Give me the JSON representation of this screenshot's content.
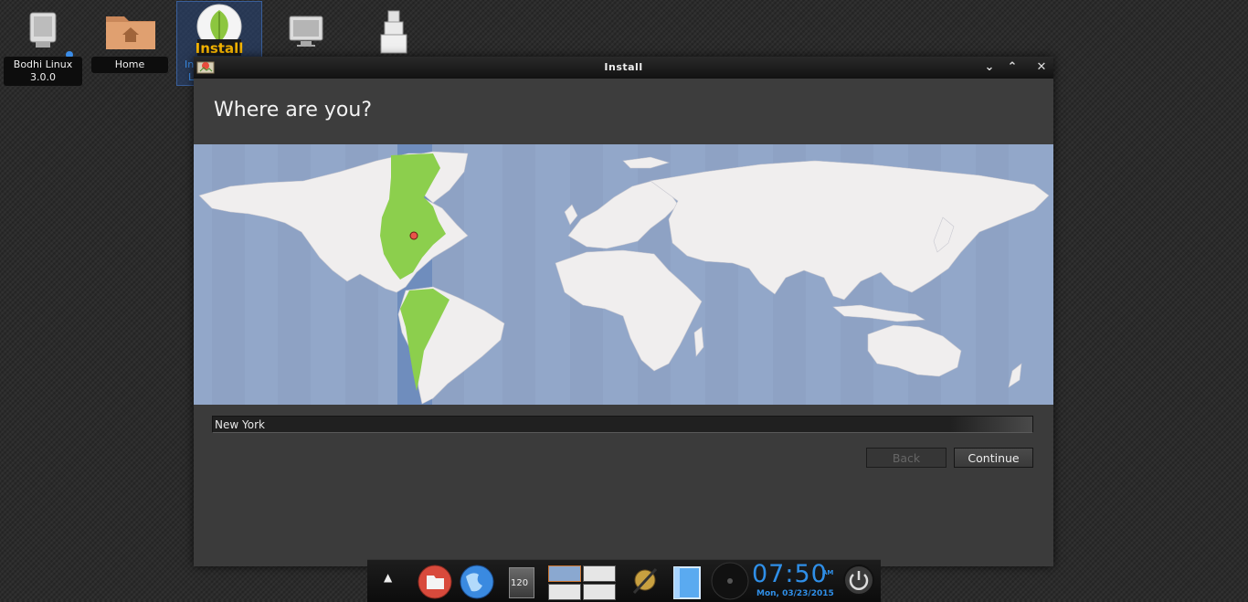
{
  "desktop": {
    "icons": [
      {
        "label": "Bodhi Linux\n3.0.0",
        "line1": "Bodhi Linux",
        "line2": "3.0.0"
      },
      {
        "label": "Home"
      },
      {
        "label_partial_1": "In",
        "label_partial_2": "L"
      },
      {
        "label": ""
      },
      {
        "label": ""
      }
    ],
    "install_icon_text": "Install"
  },
  "window": {
    "title": "Install",
    "minimize_symbol": "⌄",
    "maximize_symbol": "⌃",
    "close_symbol": "✕"
  },
  "page": {
    "heading": "Where are you?",
    "location_value": "New York",
    "back_label": "Back",
    "continue_label": "Continue"
  },
  "taskbar": {
    "arrow": "▲",
    "cpu_value": "120",
    "clock_time": "07:50",
    "clock_ampm": "AM",
    "clock_date": "Mon, 03/23/2015"
  },
  "colors": {
    "ocean": "#92a7c9",
    "land": "#f0eeee",
    "timezone_highlight": "#8ccf4d",
    "accent_blue": "#2f8fe8"
  }
}
